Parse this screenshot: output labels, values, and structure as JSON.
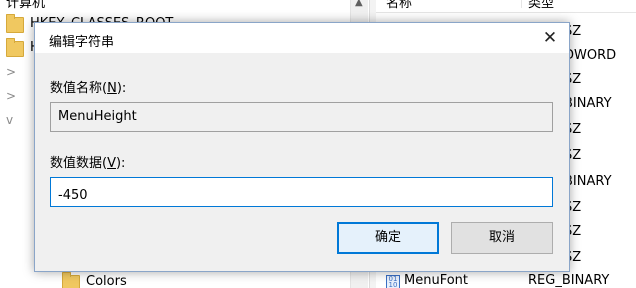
{
  "regedit": {
    "tree_header": "计算机",
    "tree_rows": [
      {
        "text": "HKEY_CLASSES_ROOT",
        "chevron": ""
      },
      {
        "text": "H",
        "chevron": ""
      },
      {
        "text": "",
        "chevron": ">"
      },
      {
        "text": "",
        "chevron": ">"
      },
      {
        "text": "",
        "chevron": "v"
      },
      {
        "text": "Colors",
        "chevron": ""
      }
    ],
    "list_headers": {
      "name": "名称",
      "type": "类型"
    },
    "type_cells": [
      "SZ",
      "DWORD",
      "SZ",
      "BINARY",
      "SZ",
      "SZ",
      "BINARY",
      "SZ",
      "SZ",
      "SZ"
    ],
    "last_row": {
      "name": "MenuFont",
      "type": "REG_BINARY",
      "icon": "binary-value-icon"
    }
  },
  "dialog": {
    "title": "编辑字符串",
    "close_icon": "close-icon",
    "name_label": {
      "prefix": "数值名称(",
      "key": "N",
      "suffix": "):"
    },
    "name_value": "MenuHeight",
    "data_label": {
      "prefix": "数值数据(",
      "key": "V",
      "suffix": "):"
    },
    "data_value": "-450",
    "ok_label": "确定",
    "cancel_label": "取消"
  },
  "colors": {
    "accent": "#0078d7",
    "dialog_bg": "#f0f0f0",
    "folder": "#f0c860"
  }
}
